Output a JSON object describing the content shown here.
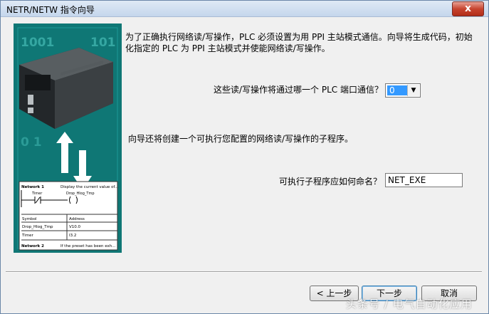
{
  "window": {
    "title": "NETR/NETW 指令向导",
    "close_glyph": "x"
  },
  "intro_text": "为了正确执行网络读/写操作，PLC 必须设置为用 PPI 主站模式通信。向导将生成代码，初始化指定的 PLC 为 PPI 主站模式并使能网络读/写操作。",
  "port_question": "这些读/写操作将通过哪一个 PLC 端口通信？",
  "port_select": {
    "value": "0"
  },
  "subroutine_text": "向导还将创建一个可执行您配置的网络读/写操作的子程序。",
  "name_question": "可执行子程序应如何命名？",
  "name_input": {
    "value": "NET_EXE"
  },
  "buttons": {
    "back": "< 上一步",
    "next": "下一步",
    "cancel": "取消"
  },
  "side_image": {
    "digits_top": "1001",
    "digits_top2": "101",
    "digits_bottom": "0 1",
    "ladder": {
      "network1_label": "Network 1",
      "network1_comment": "Display the current value of...",
      "contact_label": "Timer",
      "coil_label": "Drop_Hlog_Tmp",
      "table_headers": [
        "Symbol",
        "Address"
      ],
      "table_rows": [
        [
          "Drop_Hlog_Tmp",
          "V10.0"
        ],
        [
          "Timer",
          "I3.2"
        ]
      ],
      "network2_label": "Network 2",
      "network2_comment": "If the preset has been exh..."
    }
  },
  "watermark": "头条号 / 电气自动化应用",
  "colors": {
    "accent_select": "#3399ff",
    "image_bg": "#0f7775",
    "close_red": "#c7442f"
  }
}
